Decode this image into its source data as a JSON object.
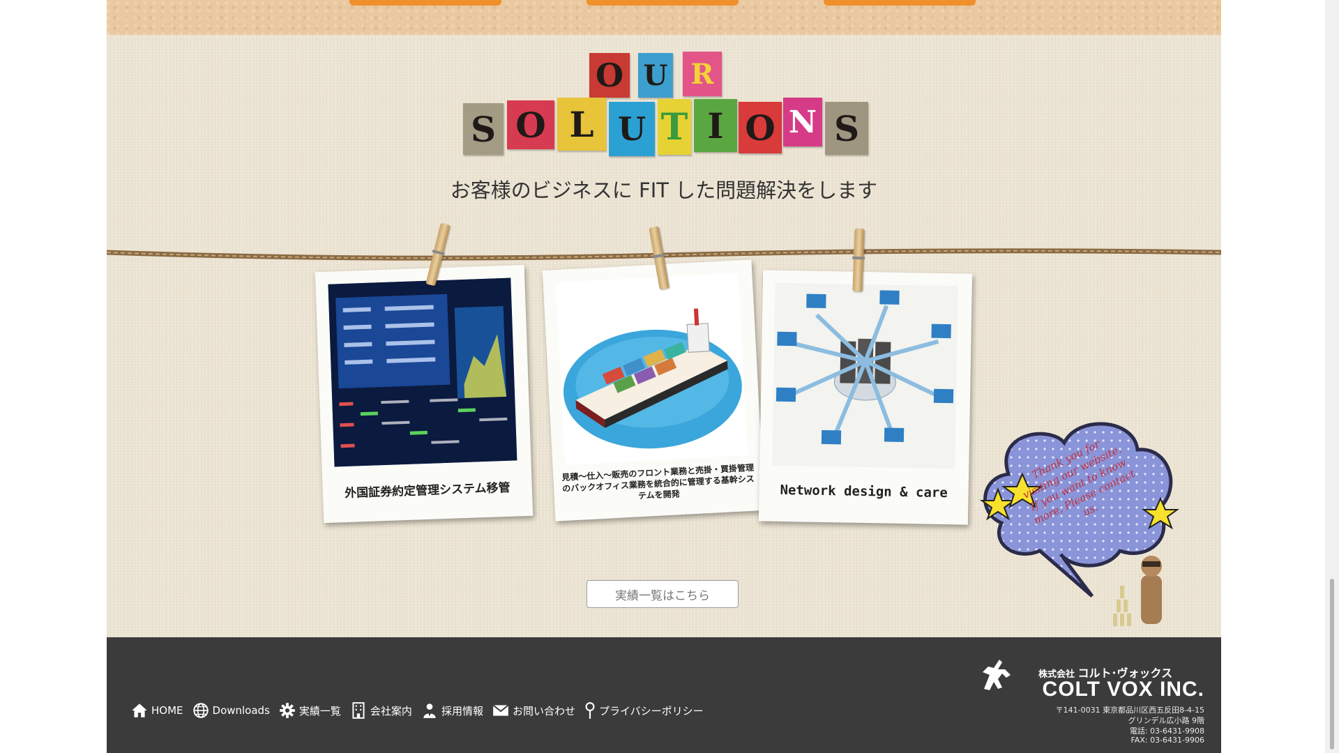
{
  "title_line1": [
    "O",
    "U",
    "R"
  ],
  "title_line2": [
    "S",
    "O",
    "L",
    "U",
    "T",
    "I",
    "O",
    "N",
    "S"
  ],
  "tagline": "お客様のビジネスに FIT した問題解決をします",
  "cards": [
    {
      "caption": "外国証券約定管理システム移管"
    },
    {
      "caption": "見積～仕入～販売のフロント業務と売掛・買掛管理のバックオフィス業務を統合的に管理する基幹システムを開発"
    },
    {
      "caption": "Network design & care"
    }
  ],
  "results_button": "実績一覧はこちら",
  "speech_bubble": "Thank you for visiting our website. If you want to know more, Please contact us.",
  "footer": {
    "nav": [
      {
        "label": "HOME",
        "icon": "home-icon"
      },
      {
        "label": "Downloads",
        "icon": "globe-icon"
      },
      {
        "label": "実績一覧",
        "icon": "gear-icon"
      },
      {
        "label": "会社案内",
        "icon": "building-icon"
      },
      {
        "label": "採用情報",
        "icon": "person-icon"
      },
      {
        "label": "お問い合わせ",
        "icon": "mail-icon"
      },
      {
        "label": "プライバシーポリシー",
        "icon": "pin-icon"
      }
    ],
    "company_prefix": "株式会社",
    "company_kana": "コルト･ヴォックス",
    "company_name": "COLT VOX INC.",
    "address1": "〒141-0031 東京都品川区西五反田8-4-15",
    "address2": "グリンデル広小路 9階",
    "phone": "電話: 03-6431-9908",
    "fax": "FAX: 03-6431-9906"
  },
  "colors": {
    "footer_bg": "#3b3b3b",
    "top_band": "#eac9a0",
    "orange_tab": "#f0902a",
    "bubble": "#8a94d8"
  }
}
